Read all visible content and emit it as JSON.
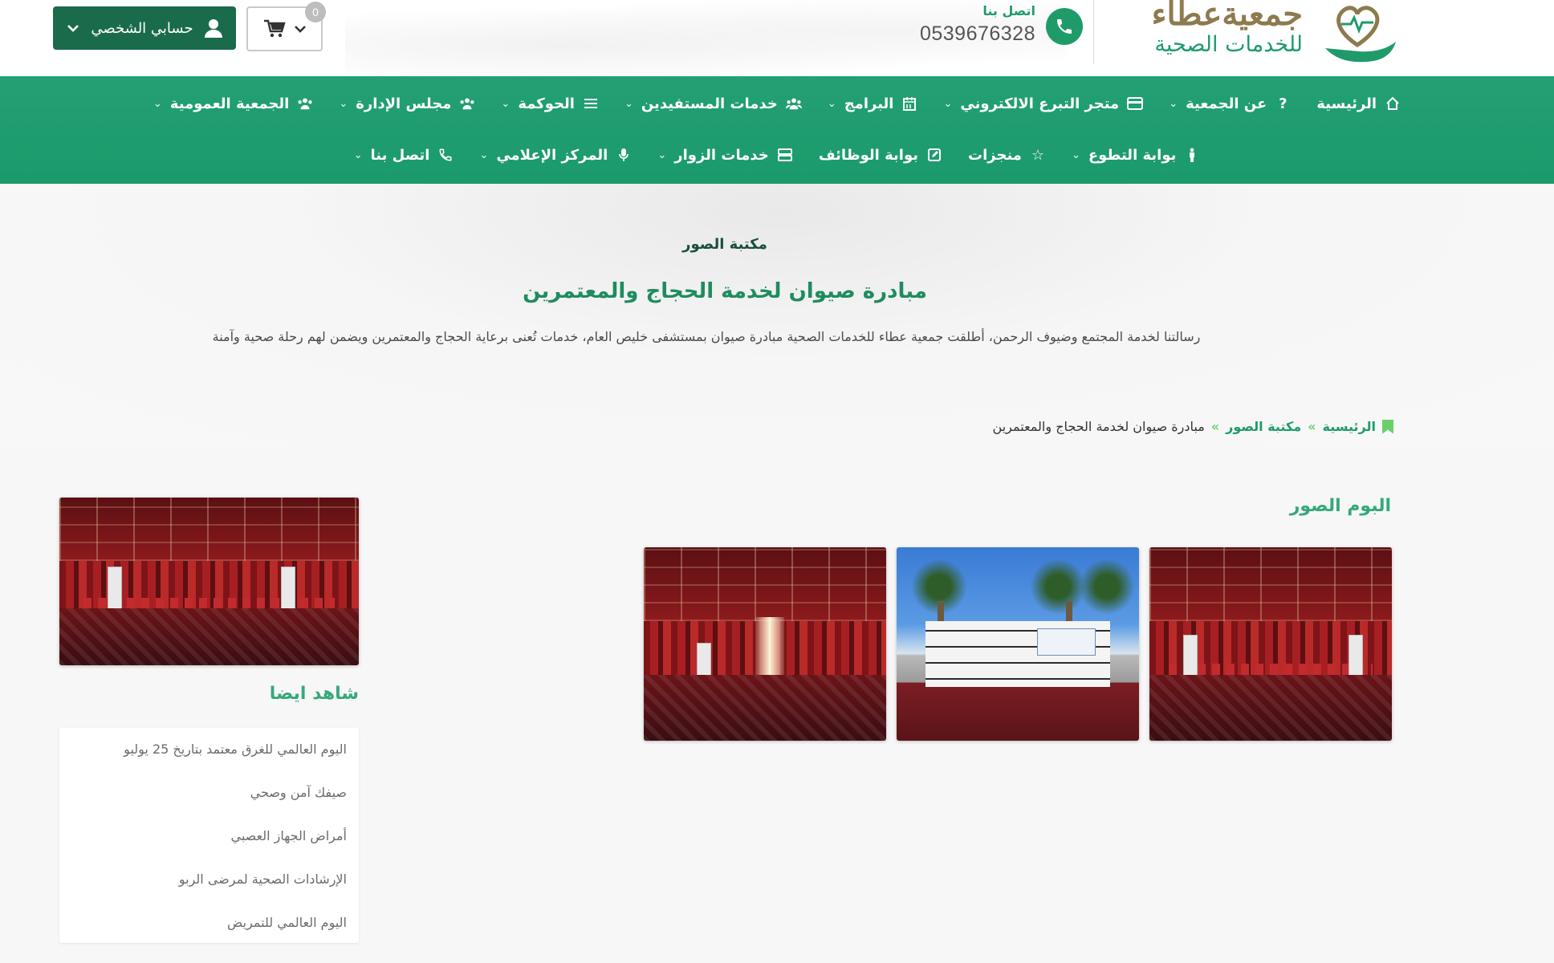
{
  "header": {
    "logo_title": "جمعيةعطاء",
    "logo_subtitle": "للخدمات الصحية",
    "contact_label": "اتصل بنا",
    "contact_phone": "0539676328",
    "cart_count": "0",
    "account_label": "حسابي الشخصي",
    "brand_green": "#1f9b6a",
    "brand_dark_green": "#1a6b4c",
    "brand_gold": "#8d7a4f"
  },
  "nav": {
    "row1": [
      {
        "label": "الرئيسية",
        "icon": "home-icon",
        "has_dropdown": false
      },
      {
        "label": "عن الجمعية",
        "icon": "question-icon",
        "has_dropdown": true
      },
      {
        "label": "متجر التبرع الالكتروني",
        "icon": "credit-card-icon",
        "has_dropdown": true
      },
      {
        "label": "البرامج",
        "icon": "calendar-icon",
        "has_dropdown": true
      },
      {
        "label": "خدمات المستفيدين",
        "icon": "users-icon",
        "has_dropdown": true
      },
      {
        "label": "الحوكمة",
        "icon": "list-icon",
        "has_dropdown": true
      },
      {
        "label": "مجلس الإدارة",
        "icon": "users-icon",
        "has_dropdown": true
      },
      {
        "label": "الجمعية العمومية",
        "icon": "users-icon",
        "has_dropdown": true
      }
    ],
    "row2": [
      {
        "label": "بوابة التطوع",
        "icon": "person-icon",
        "has_dropdown": true
      },
      {
        "label": "منجزات",
        "icon": "star-icon",
        "has_dropdown": false
      },
      {
        "label": "بوابة الوظائف",
        "icon": "edit-icon",
        "has_dropdown": false
      },
      {
        "label": "خدمات الزوار",
        "icon": "server-icon",
        "has_dropdown": true
      },
      {
        "label": "المركز الإعلامي",
        "icon": "microphone-icon",
        "has_dropdown": true
      },
      {
        "label": "اتصل بنا",
        "icon": "phone-icon",
        "has_dropdown": true
      }
    ]
  },
  "hero": {
    "kicker": "مكتبة الصور",
    "title": "مبادرة صيوان لخدمة الحجاج والمعتمرين",
    "description": "رسالتنا لخدمة المجتمع وضيوف الرحمن، أطلقت  جمعية عطاء للخدمات الصحية مبادرة صيوان بمستشفى خليص العام، خدمات تُعنى برعاية الحجاج والمعتمرين ويضمن لهم رحلة صحية وآمنة"
  },
  "breadcrumb": {
    "home": "الرئيسية",
    "section": "مكتبة الصور",
    "current": "مبادرة صيوان لخدمة الحجاج والمعتمرين",
    "separator": "»"
  },
  "album": {
    "heading": "البوم الصور",
    "photos": [
      {
        "name": "tent-interior-photo-1"
      },
      {
        "name": "tent-exterior-photo"
      },
      {
        "name": "tent-interior-photo-2"
      }
    ]
  },
  "sidebar": {
    "heading": "شاهد ايضا",
    "links": [
      "اليوم العالمي للغرق معتمد بتاريخ 25 يوليو",
      "صيفك آمن وصحي",
      "أمراض الجهاز العصبي",
      "الإرشادات الصحية لمرضى الربو",
      "اليوم العالمي للتمريض"
    ]
  }
}
